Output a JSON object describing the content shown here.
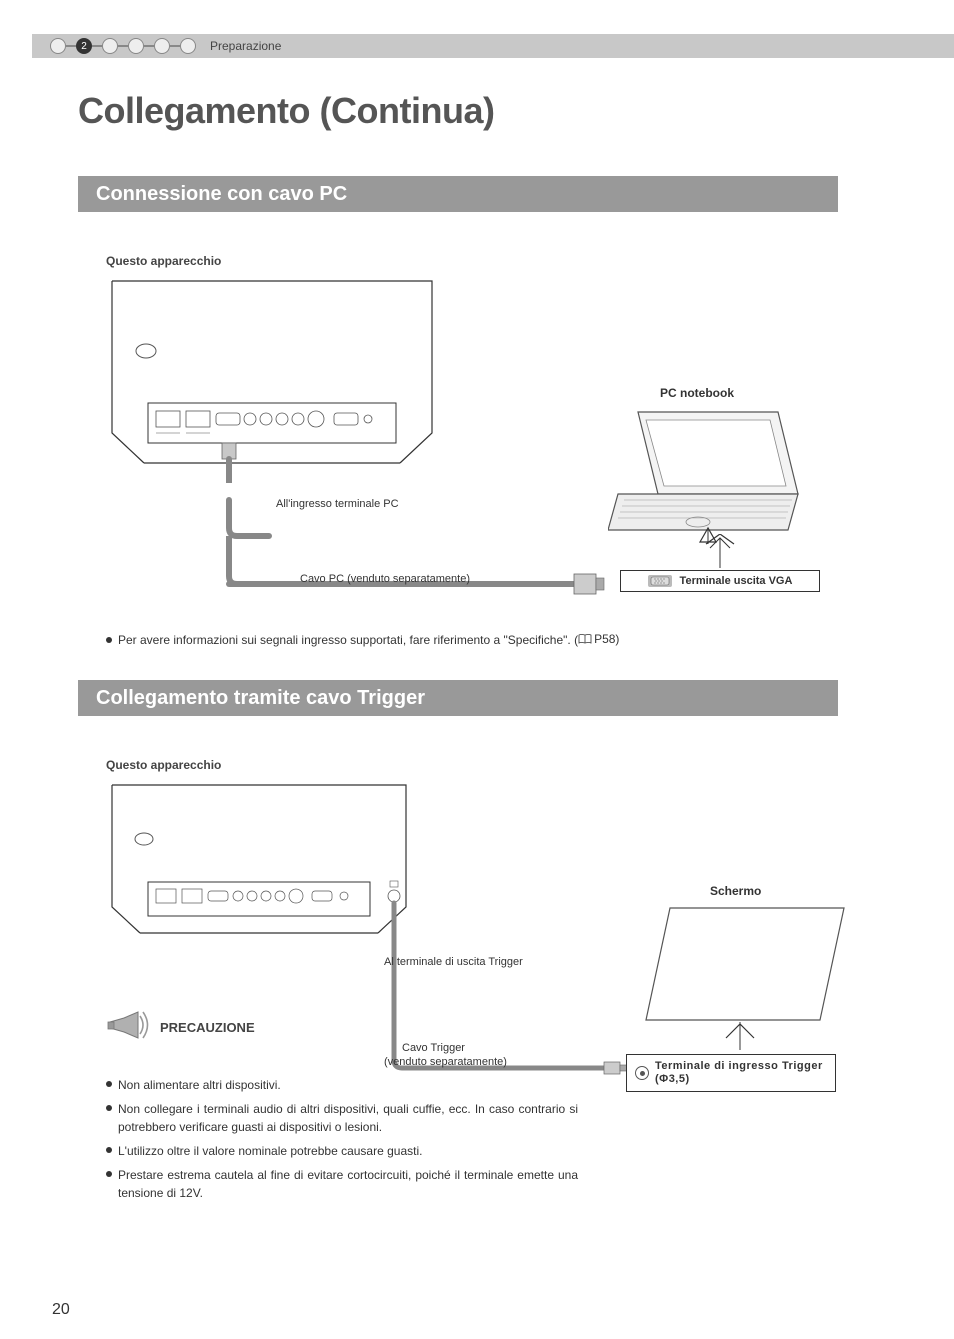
{
  "header": {
    "breadcrumb": "Preparazione",
    "active_step": 2,
    "total_steps": 6
  },
  "title": "Collegamento (Continua)",
  "section1": {
    "heading": "Connessione con cavo PC",
    "device_label": "Questo apparecchio",
    "laptop_label": "PC notebook",
    "pc_terminal_label": "All'ingresso terminale PC",
    "cable_label": "Cavo PC (venduto separatamente)",
    "vga_out_label": "Terminale uscita VGA",
    "note": "Per avere informazioni sui segnali ingresso supportati, fare riferimento a \"Specifiche\". (",
    "note_ref": "P58)"
  },
  "section2": {
    "heading": "Collegamento tramite cavo Trigger",
    "device_label": "Questo apparecchio",
    "screen_label": "Schermo",
    "trigger_out_label": "Al terminale di uscita Trigger",
    "cable_label_a": "Cavo Trigger",
    "cable_label_b": "(venduto separatamente)",
    "trigger_in_label": "Terminale di ingresso Trigger (Φ3,5)",
    "caution_label": "PRECAUZIONE",
    "warnings": [
      "Non alimentare altri dispositivi.",
      "Non collegare i terminali audio di altri dispositivi, quali cuffie, ecc. In caso contrario si potrebbero verificare guasti ai dispositivi o lesioni.",
      "L'utilizzo oltre il valore nominale potrebbe causare guasti.",
      "Prestare estrema cautela al fine di evitare cortocircuiti, poiché il terminale emette una tensione di 12V."
    ]
  },
  "page_number": "20"
}
